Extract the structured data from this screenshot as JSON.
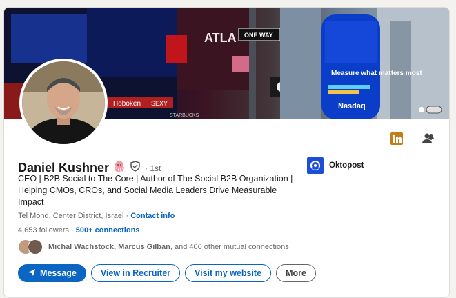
{
  "profile": {
    "name": "Daniel Kushner",
    "degree": "· 1st",
    "headline": "CEO | B2B Social to The Core | Author of The Social B2B Organization | Helping CMOs, CROs, and Social Media Leaders Drive Measurable Impact",
    "location": "Tel Mond, Center District, Israel",
    "contact_info": "Contact info",
    "followers": "4,653 followers",
    "connections": "500+ connections",
    "mutual": {
      "names": "Michal Wachstock, Marcus Gilban",
      "rest": ", and 406 other mutual connections"
    }
  },
  "company": {
    "name": "Oktopost"
  },
  "banner_text": {
    "nasdaq_screen": "Measure what matters most",
    "nasdaq_logo": "Nasdaq",
    "street_sign": "ONE WAY",
    "brand_sign": "ATLA",
    "shop_sign_1": "Hoboken",
    "shop_sign_2": "SEXY",
    "shop_sign_3": "STARBUCKS"
  },
  "actions": {
    "message": "Message",
    "recruiter": "View in Recruiter",
    "website": "Visit my website",
    "more": "More"
  },
  "colors": {
    "primary": "#0a66c2",
    "linkedin_orange": "#c37d16",
    "company_blue": "#1d4ed8"
  },
  "icons": {
    "linkedin_badge": "linkedin-premium-icon",
    "follow": "person-bell-icon",
    "verified": "shield-check-icon",
    "send": "paper-plane-icon"
  }
}
